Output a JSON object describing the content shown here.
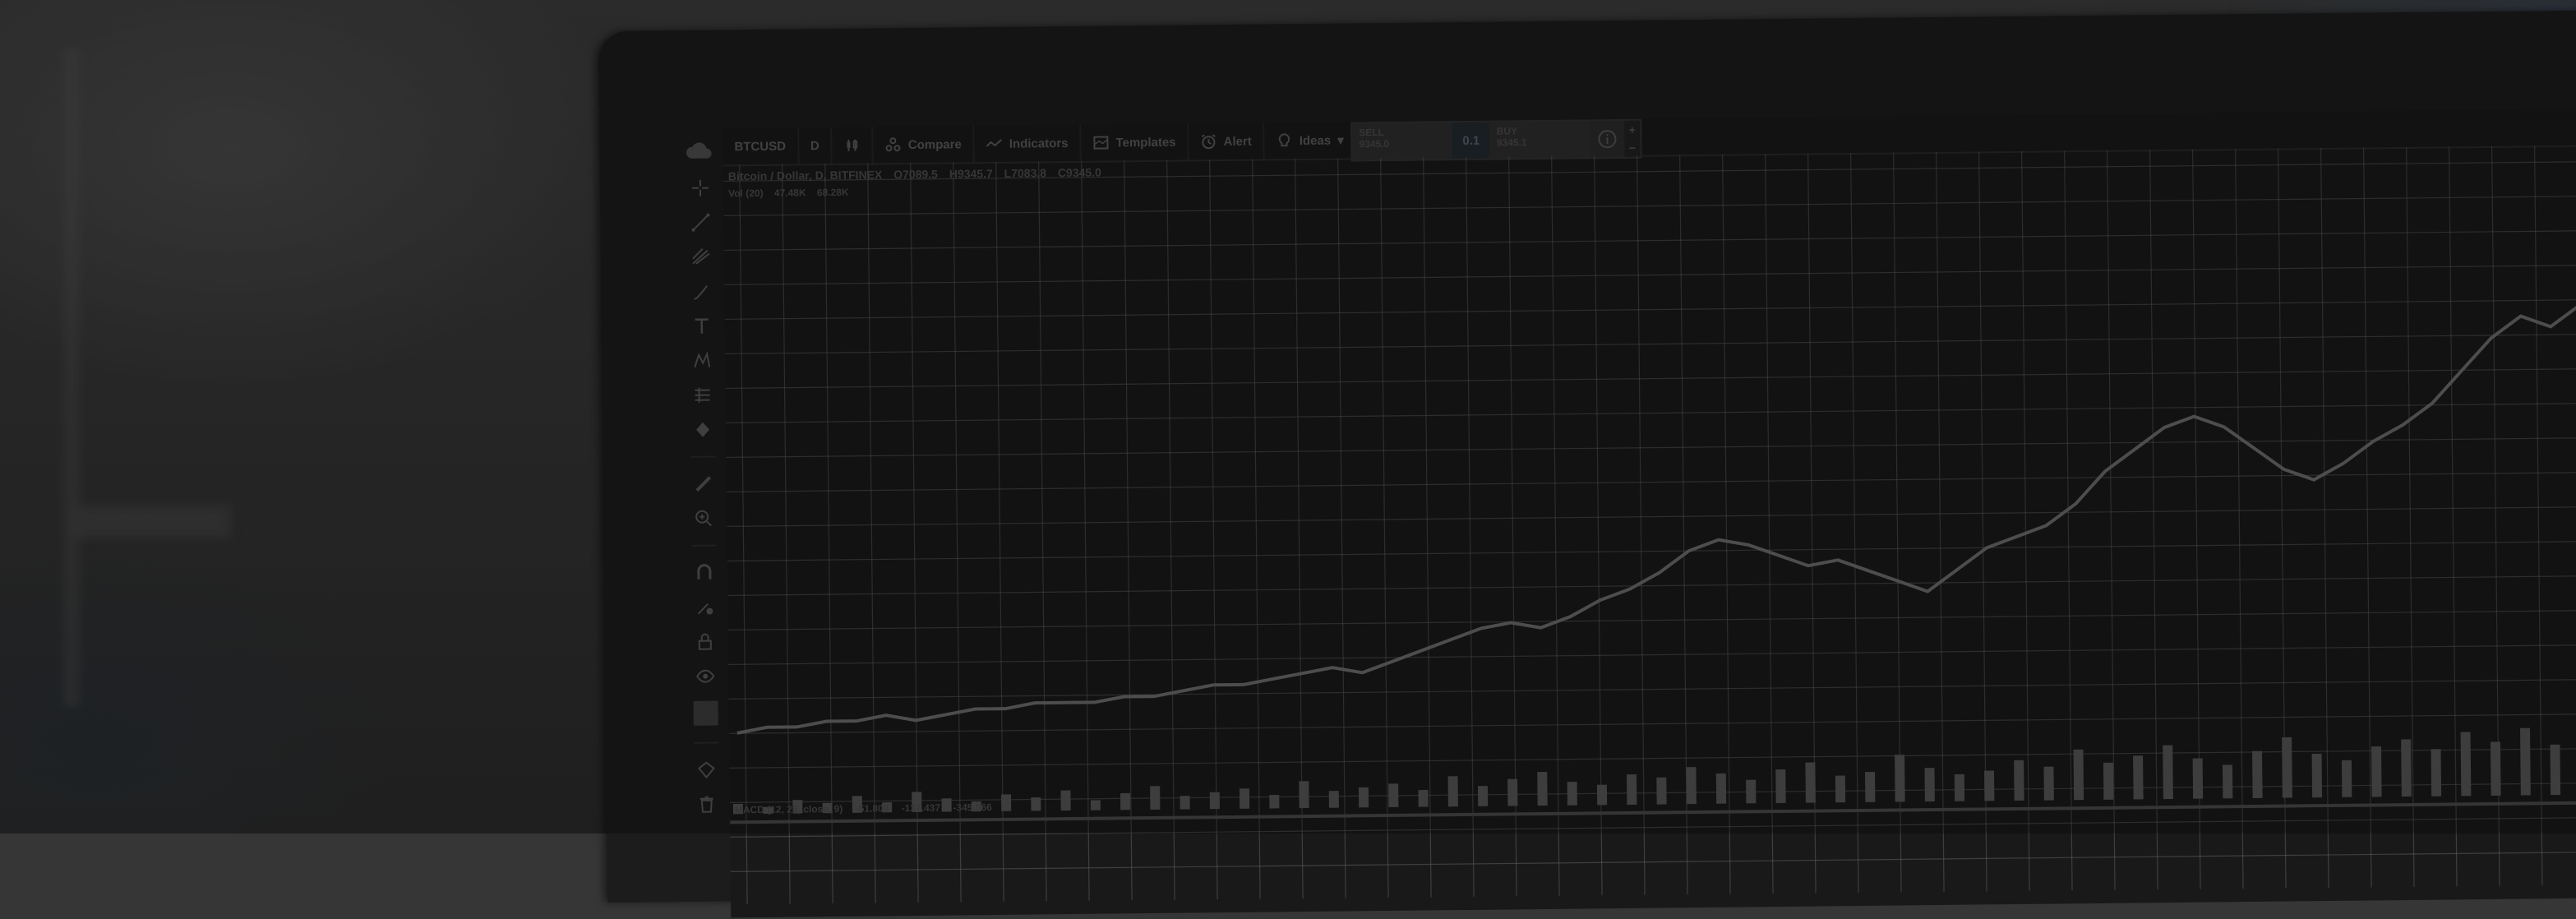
{
  "topbar": {
    "symbol": "BTCUSD",
    "interval": "D",
    "compare": "Compare",
    "indicators": "Indicators",
    "templates": "Templates",
    "alert": "Alert",
    "ideas": "Ideas"
  },
  "trade_widget": {
    "sell_label": "SELL",
    "sell_price": "9345.0",
    "spread": "0.1",
    "buy_label": "BUY",
    "buy_price": "9345.1",
    "plus": "+",
    "minus": "−"
  },
  "legend": {
    "title": "Bitcoin / Dollar, D, BITFINEX",
    "ohlc": [
      "O7089.5",
      "H9345.7",
      "L7083.8",
      "C9345.0"
    ],
    "volume_label": "Vol (20)",
    "volume_values": [
      "47.48K",
      "68.28K"
    ]
  },
  "indicator_legend": {
    "label": "MACD (12, 26, close, 9)",
    "values": [
      "-51.809",
      "-137.437",
      "-345.066"
    ]
  },
  "colors": {
    "grid": "#5e5e5e",
    "price_line": "#6b6b6b",
    "volume": "#555555",
    "background": "#191919"
  },
  "chart_data": {
    "type": "line",
    "note_units": "",
    "series": [
      {
        "values": [
          12,
          13,
          13,
          14,
          14,
          15,
          14,
          15,
          16,
          16,
          17,
          17,
          17,
          18,
          18,
          19,
          20,
          20,
          21,
          22,
          23,
          22,
          24,
          26,
          28,
          30,
          31,
          30,
          32,
          35,
          37,
          40,
          44,
          46,
          45,
          43,
          41,
          42,
          40,
          38,
          36,
          40,
          44,
          46,
          48,
          52,
          58,
          62,
          66,
          68,
          66,
          62,
          58,
          56,
          59,
          63,
          66,
          70,
          76,
          82,
          86,
          84,
          88,
          95,
          100
        ]
      }
    ],
    "volume": [
      3,
      2,
      4,
      3,
      5,
      3,
      6,
      4,
      3,
      5,
      4,
      6,
      3,
      5,
      7,
      4,
      5,
      6,
      4,
      8,
      5,
      6,
      7,
      5,
      9,
      6,
      8,
      10,
      7,
      6,
      9,
      8,
      11,
      9,
      7,
      10,
      12,
      8,
      9,
      14,
      10,
      8,
      9,
      12,
      10,
      15,
      11,
      13,
      16,
      12,
      10,
      14,
      18,
      13,
      11,
      15,
      17,
      14,
      19,
      16,
      20,
      15,
      18,
      22,
      19
    ],
    "ylim": [
      0,
      110
    ],
    "grid": true,
    "legend_position": "top-left"
  }
}
